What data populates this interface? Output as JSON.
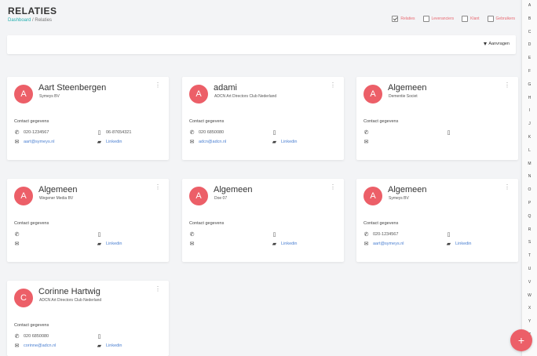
{
  "header": {
    "title": "RELATIES",
    "breadcrumb": {
      "home": "Dashboard",
      "separator": "/",
      "current": "Relaties"
    }
  },
  "filters": [
    {
      "label": "Relaties",
      "checked": true
    },
    {
      "label": "Leveranciers",
      "checked": false
    },
    {
      "label": "Klant",
      "checked": false
    },
    {
      "label": "Gebruikers",
      "checked": false
    }
  ],
  "toolbar": {
    "sort_label": "Aanvragen"
  },
  "section_label": "Contact gegevens",
  "cards": [
    {
      "initial": "A",
      "name": "Aart Steenbergen",
      "org": "Symeys BV",
      "phone": "020-1234567",
      "mobile": "06-87654321",
      "email": "aart@symeys.nl",
      "linkedin": "Linkedin"
    },
    {
      "initial": "A",
      "name": "adami",
      "org": "ADCN Art Directors Club Nederland",
      "phone": "020 6850080",
      "mobile": "",
      "email": "adcn@adcn.nl",
      "linkedin": "Linkedin"
    },
    {
      "initial": "A",
      "name": "Algemeen",
      "org": "Dementie Societ",
      "phone": "",
      "mobile": "",
      "email": "",
      "linkedin": ""
    },
    {
      "initial": "A",
      "name": "Algemeen",
      "org": "Wegener Media BV",
      "phone": "",
      "mobile": "",
      "email": "",
      "linkedin": "Linkedin"
    },
    {
      "initial": "A",
      "name": "Algemeen",
      "org": "Doe 07",
      "phone": "",
      "mobile": "",
      "email": "",
      "linkedin": "Linkedin"
    },
    {
      "initial": "A",
      "name": "Algemeen",
      "org": "Symeys BV",
      "phone": "020-1234567",
      "mobile": "",
      "email": "aart@symeys.nl",
      "linkedin": "Linkedin"
    },
    {
      "initial": "C",
      "name": "Corinne Hartwig",
      "org": "ADCN Art Directors Club Nederland",
      "phone": "020 6850080",
      "mobile": "",
      "email": "corinne@adcn.nl",
      "linkedin": "Linkedin"
    }
  ],
  "alphabet": [
    "A",
    "B",
    "C",
    "D",
    "E",
    "F",
    "G",
    "H",
    "I",
    "J",
    "K",
    "L",
    "M",
    "N",
    "O",
    "P",
    "Q",
    "R",
    "S",
    "T",
    "U",
    "V",
    "W",
    "X",
    "Y",
    "Z"
  ],
  "fab_label": "+",
  "colors": {
    "accent": "#ec5f68",
    "link": "#4a7fd1",
    "breadcrumb_link": "#25b0b0"
  }
}
